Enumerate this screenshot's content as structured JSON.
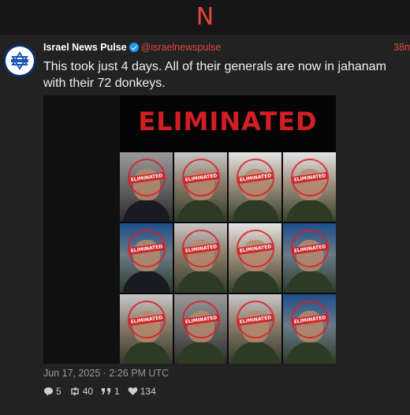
{
  "app": {
    "logo_letter": "N",
    "accent": "#e0483f"
  },
  "tweet": {
    "author_name": "Israel News Pulse",
    "handle": "@israelnewspulse",
    "relative_time": "38m",
    "text": "This took just 4 days. All of their generals are now in jahanam with their 72 donkeys.",
    "media": {
      "title": "ELIMINATED",
      "stamp_text": "ELIMINATED",
      "tile_count": 12
    },
    "date": "Jun 17, 2025 · 2:26 PM UTC",
    "stats": {
      "replies": "5",
      "retweets": "40",
      "quotes": "1",
      "likes": "134"
    }
  }
}
